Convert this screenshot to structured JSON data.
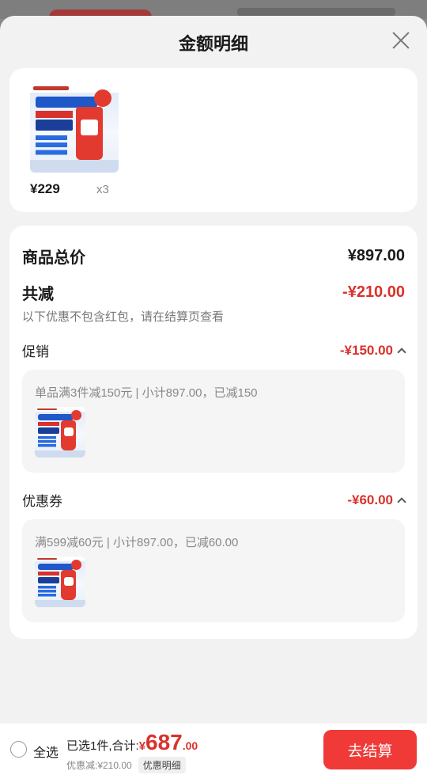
{
  "sheet": {
    "title": "金额明细"
  },
  "product": {
    "price": "¥229",
    "quantity": "x3"
  },
  "summary": {
    "total_label": "商品总价",
    "total_value": "¥897.00",
    "reduce_label": "共减",
    "reduce_value": "-¥210.00",
    "note": "以下优惠不包含红包，请在结算页查看"
  },
  "promotion": {
    "label": "促销",
    "value": "-¥150.00",
    "detail": "单品满3件减150元 | 小计897.00，已减150"
  },
  "coupon": {
    "label": "优惠券",
    "value": "-¥60.00",
    "detail": "满599减60元 | 小计897.00，已减60.00"
  },
  "footer": {
    "select_all": "全选",
    "selected_text": "已选1件,合计:",
    "currency": "¥",
    "amount_int": "687",
    "amount_dec": ".00",
    "discount_text": "优惠减:¥210.00",
    "detail_link": "优惠明细",
    "checkout": "去结算"
  },
  "colors": {
    "accent": "#d9322c",
    "button": "#ef3a37",
    "sheet_bg": "#f2f2f2"
  }
}
